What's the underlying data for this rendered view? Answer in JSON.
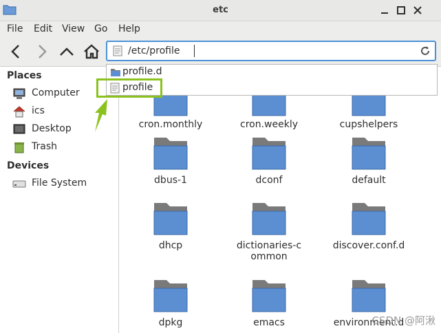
{
  "window": {
    "title": "etc"
  },
  "menu": [
    "File",
    "Edit",
    "View",
    "Go",
    "Help"
  ],
  "location": {
    "path": "/etc/profile"
  },
  "autocomplete": [
    {
      "label": "profile.d",
      "icon": "folder-icon"
    },
    {
      "label": "profile",
      "icon": "text-file-icon"
    }
  ],
  "sidebar": {
    "places_heading": "Places",
    "places": [
      {
        "label": "Computer",
        "icon": "computer-icon"
      },
      {
        "label": "ics",
        "icon": "home-icon"
      },
      {
        "label": "Desktop",
        "icon": "desktop-icon"
      },
      {
        "label": "Trash",
        "icon": "trash-icon"
      }
    ],
    "devices_heading": "Devices",
    "devices": [
      {
        "label": "File System",
        "icon": "drive-icon"
      }
    ]
  },
  "files": [
    {
      "name": "cron.monthly"
    },
    {
      "name": "cron.weekly"
    },
    {
      "name": "cupshelpers"
    },
    {
      "name": "dbus-1"
    },
    {
      "name": "dconf"
    },
    {
      "name": "default"
    },
    {
      "name": "dhcp"
    },
    {
      "name": "dictionaries-common"
    },
    {
      "name": "discover.conf.d"
    },
    {
      "name": "dpkg"
    },
    {
      "name": "emacs"
    },
    {
      "name": "environment.d"
    }
  ],
  "watermark": "CSDN @阿湫",
  "colors": {
    "accent": "#4a90d9",
    "highlight": "#8cc21f",
    "folder": "#5b8fd1"
  }
}
